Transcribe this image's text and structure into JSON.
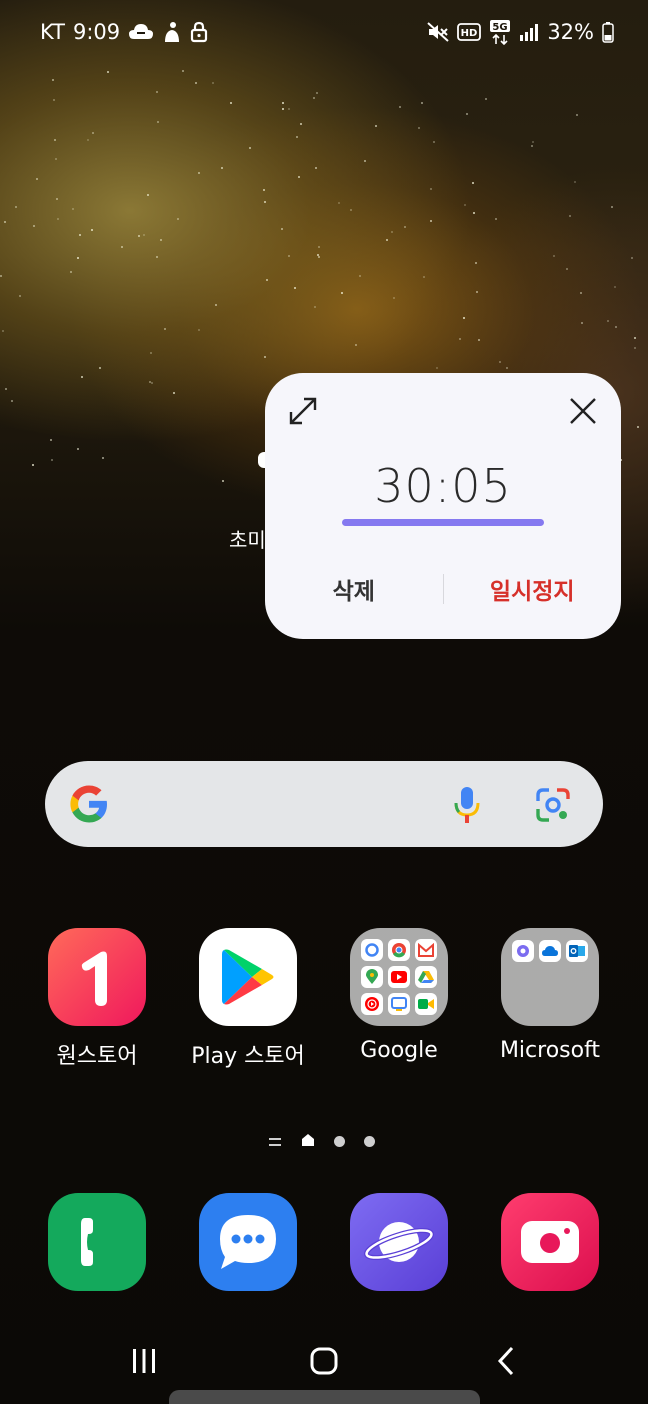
{
  "status_bar": {
    "carrier": "KT",
    "time": "9:09",
    "battery": "32%",
    "icons_left": [
      "weather-cloud-icon",
      "person-icon",
      "lock-icon"
    ],
    "icons_right": [
      "mute-icon",
      "hd-icon",
      "5g-icon",
      "signal-icon",
      "battery-icon"
    ]
  },
  "timer_popup": {
    "time": "30:05",
    "delete_label": "삭제",
    "pause_label": "일시정지",
    "accent": "#8579f0",
    "pause_color": "#d6302a"
  },
  "widget": {
    "label": "초미"
  },
  "search": {
    "logo": "google-g-icon",
    "mic": "mic-icon",
    "lens": "lens-icon"
  },
  "apps": [
    {
      "label": "원스토어",
      "icon": "onestore-icon"
    },
    {
      "label": "Play 스토어",
      "icon": "play-store-icon"
    },
    {
      "label": "Google",
      "icon": "google-folder-icon"
    },
    {
      "label": "Microsoft",
      "icon": "microsoft-folder-icon"
    }
  ],
  "dock": [
    {
      "icon": "phone-icon",
      "color": "#14a95c"
    },
    {
      "icon": "messages-icon",
      "color": "#2d7ff0"
    },
    {
      "icon": "internet-icon",
      "color": "#6e5ce0"
    },
    {
      "icon": "camera-icon",
      "color": "#e8185a"
    }
  ],
  "nav": {
    "recents": "recents-icon",
    "home": "home-icon",
    "back": "back-icon"
  }
}
